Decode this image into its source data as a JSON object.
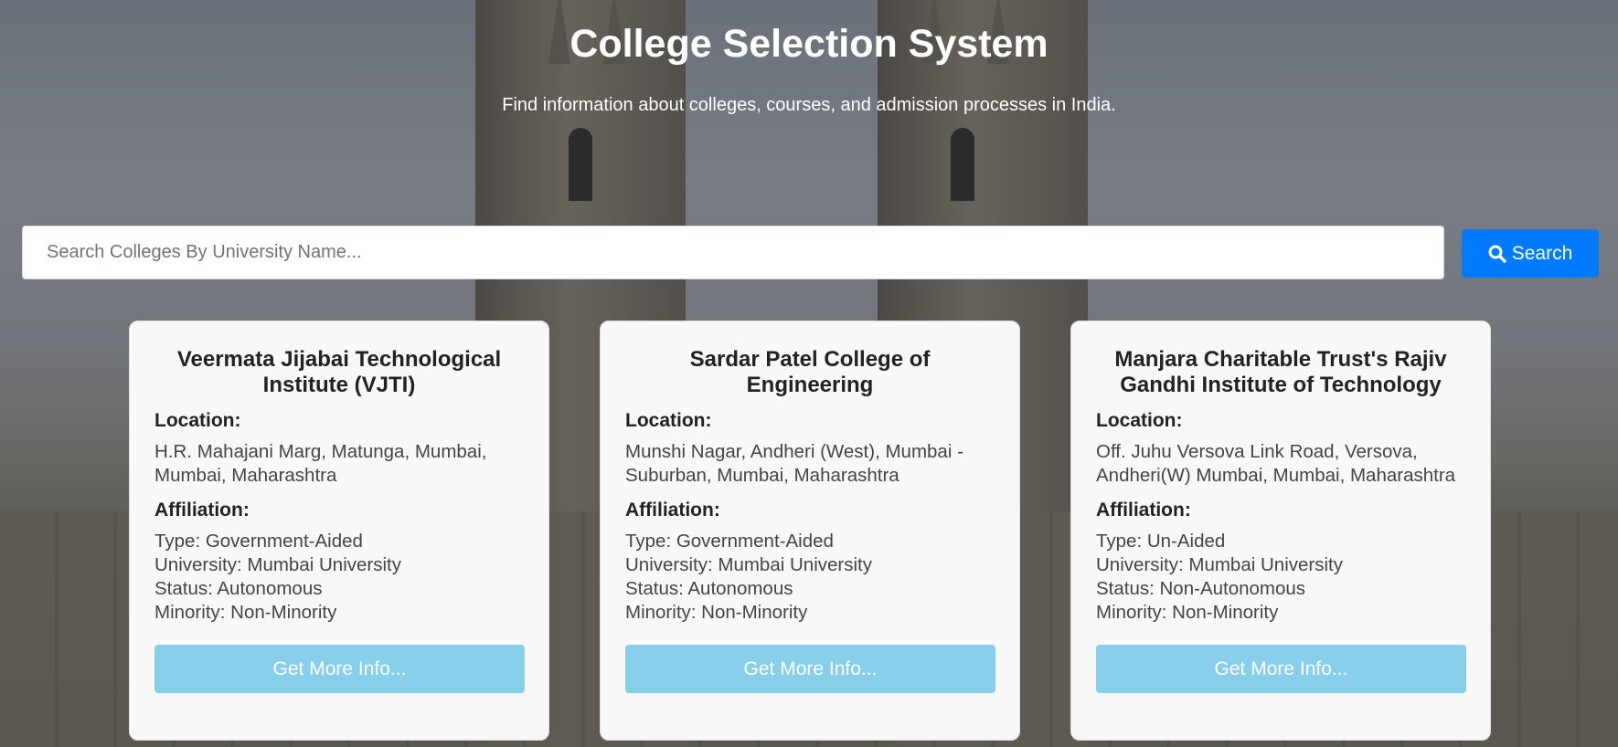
{
  "header": {
    "title": "College Selection System",
    "subtitle": "Find information about colleges, courses, and admission processes in India."
  },
  "search": {
    "placeholder": "Search Colleges By University Name...",
    "value": "",
    "button_label": "Search",
    "button_icon": "search-icon"
  },
  "colors": {
    "primary": "#007bff",
    "more_info_button": "#87ceeb",
    "card_background": "#f8f8f8"
  },
  "colleges": [
    {
      "name": "Veermata Jijabai Technological Institute (VJTI)",
      "location_label": "Location:",
      "location": "H.R. Mahajani Marg, Matunga, Mumbai, Mumbai, Maharashtra",
      "affiliation_label": "Affiliation:",
      "type": "Type: Government-Aided",
      "university": "University: Mumbai University",
      "status": "Status: Autonomous",
      "minority": "Minority: Non-Minority",
      "button_label": "Get More Info..."
    },
    {
      "name": "Sardar Patel College of Engineering",
      "location_label": "Location:",
      "location": "Munshi Nagar, Andheri (West), Mumbai - Suburban, Mumbai, Maharashtra",
      "affiliation_label": "Affiliation:",
      "type": "Type: Government-Aided",
      "university": "University: Mumbai University",
      "status": "Status: Autonomous",
      "minority": "Minority: Non-Minority",
      "button_label": "Get More Info..."
    },
    {
      "name": "Manjara Charitable Trust's Rajiv Gandhi Institute of Technology",
      "location_label": "Location:",
      "location": "Off. Juhu Versova Link Road, Versova, Andheri(W) Mumbai, Mumbai, Maharashtra",
      "affiliation_label": "Affiliation:",
      "type": "Type: Un-Aided",
      "university": "University: Mumbai University",
      "status": "Status: Non-Autonomous",
      "minority": "Minority: Non-Minority",
      "button_label": "Get More Info..."
    }
  ]
}
